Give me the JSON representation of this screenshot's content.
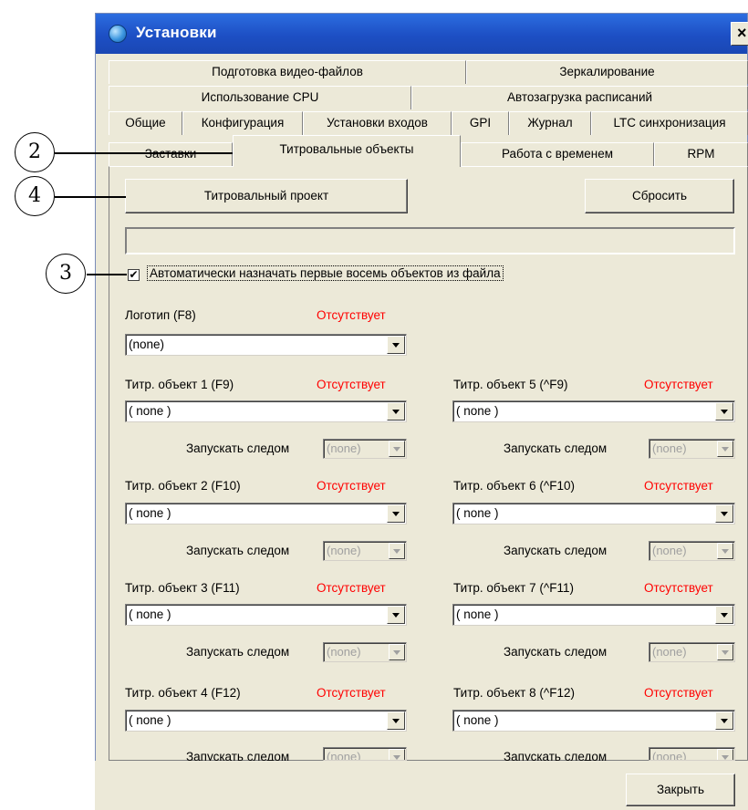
{
  "window": {
    "title": "Установки",
    "close": "×"
  },
  "tabs": {
    "row1": [
      "Подготовка видео-файлов",
      "Зеркалирование"
    ],
    "row2": [
      "Использование CPU",
      "Автозагрузка расписаний"
    ],
    "row3": [
      "Общие",
      "Конфигурация",
      "Установки входов",
      "GPI",
      "Журнал",
      "LTC синхронизация"
    ],
    "row4": [
      "Заставки",
      "Титровальные объекты",
      "Работа с временем",
      "RPM"
    ]
  },
  "panel": {
    "project_button": "Титровальный проект",
    "reset_button": "Сбросить",
    "auto_assign_checked": true,
    "auto_assign_label": "Автоматически назначать первые восемь объектов из файла",
    "logo": {
      "label": "Логотип (F8)",
      "status": "Отсутствует",
      "value": "(none)"
    },
    "run_next_label": "Запускать следом",
    "run_next_value": "(none)",
    "objects_left": [
      {
        "label": "Титр. объект 1 (F9)",
        "status": "Отсутствует",
        "value": "( none )"
      },
      {
        "label": "Титр. объект 2 (F10)",
        "status": "Отсутствует",
        "value": "( none )"
      },
      {
        "label": "Титр. объект 3 (F11)",
        "status": "Отсутствует",
        "value": "( none )"
      },
      {
        "label": "Титр. объект 4 (F12)",
        "status": "Отсутствует",
        "value": "( none )"
      }
    ],
    "objects_right": [
      {
        "label": "Титр. объект 5 (^F9)",
        "status": "Отсутствует",
        "value": "( none )"
      },
      {
        "label": "Титр. объект 6 (^F10)",
        "status": "Отсутствует",
        "value": "( none )"
      },
      {
        "label": "Титр. объект 7 (^F11)",
        "status": "Отсутствует",
        "value": "( none )"
      },
      {
        "label": "Титр. объект 8 (^F12)",
        "status": "Отсутствует",
        "value": "( none )"
      }
    ]
  },
  "footer": {
    "close_button": "Закрыть"
  },
  "callouts": [
    "2",
    "4",
    "3"
  ],
  "colors": {
    "title_bar": "#1d4fc4",
    "status_missing": "#ff0000",
    "dialog_bg": "#ece9d8"
  }
}
